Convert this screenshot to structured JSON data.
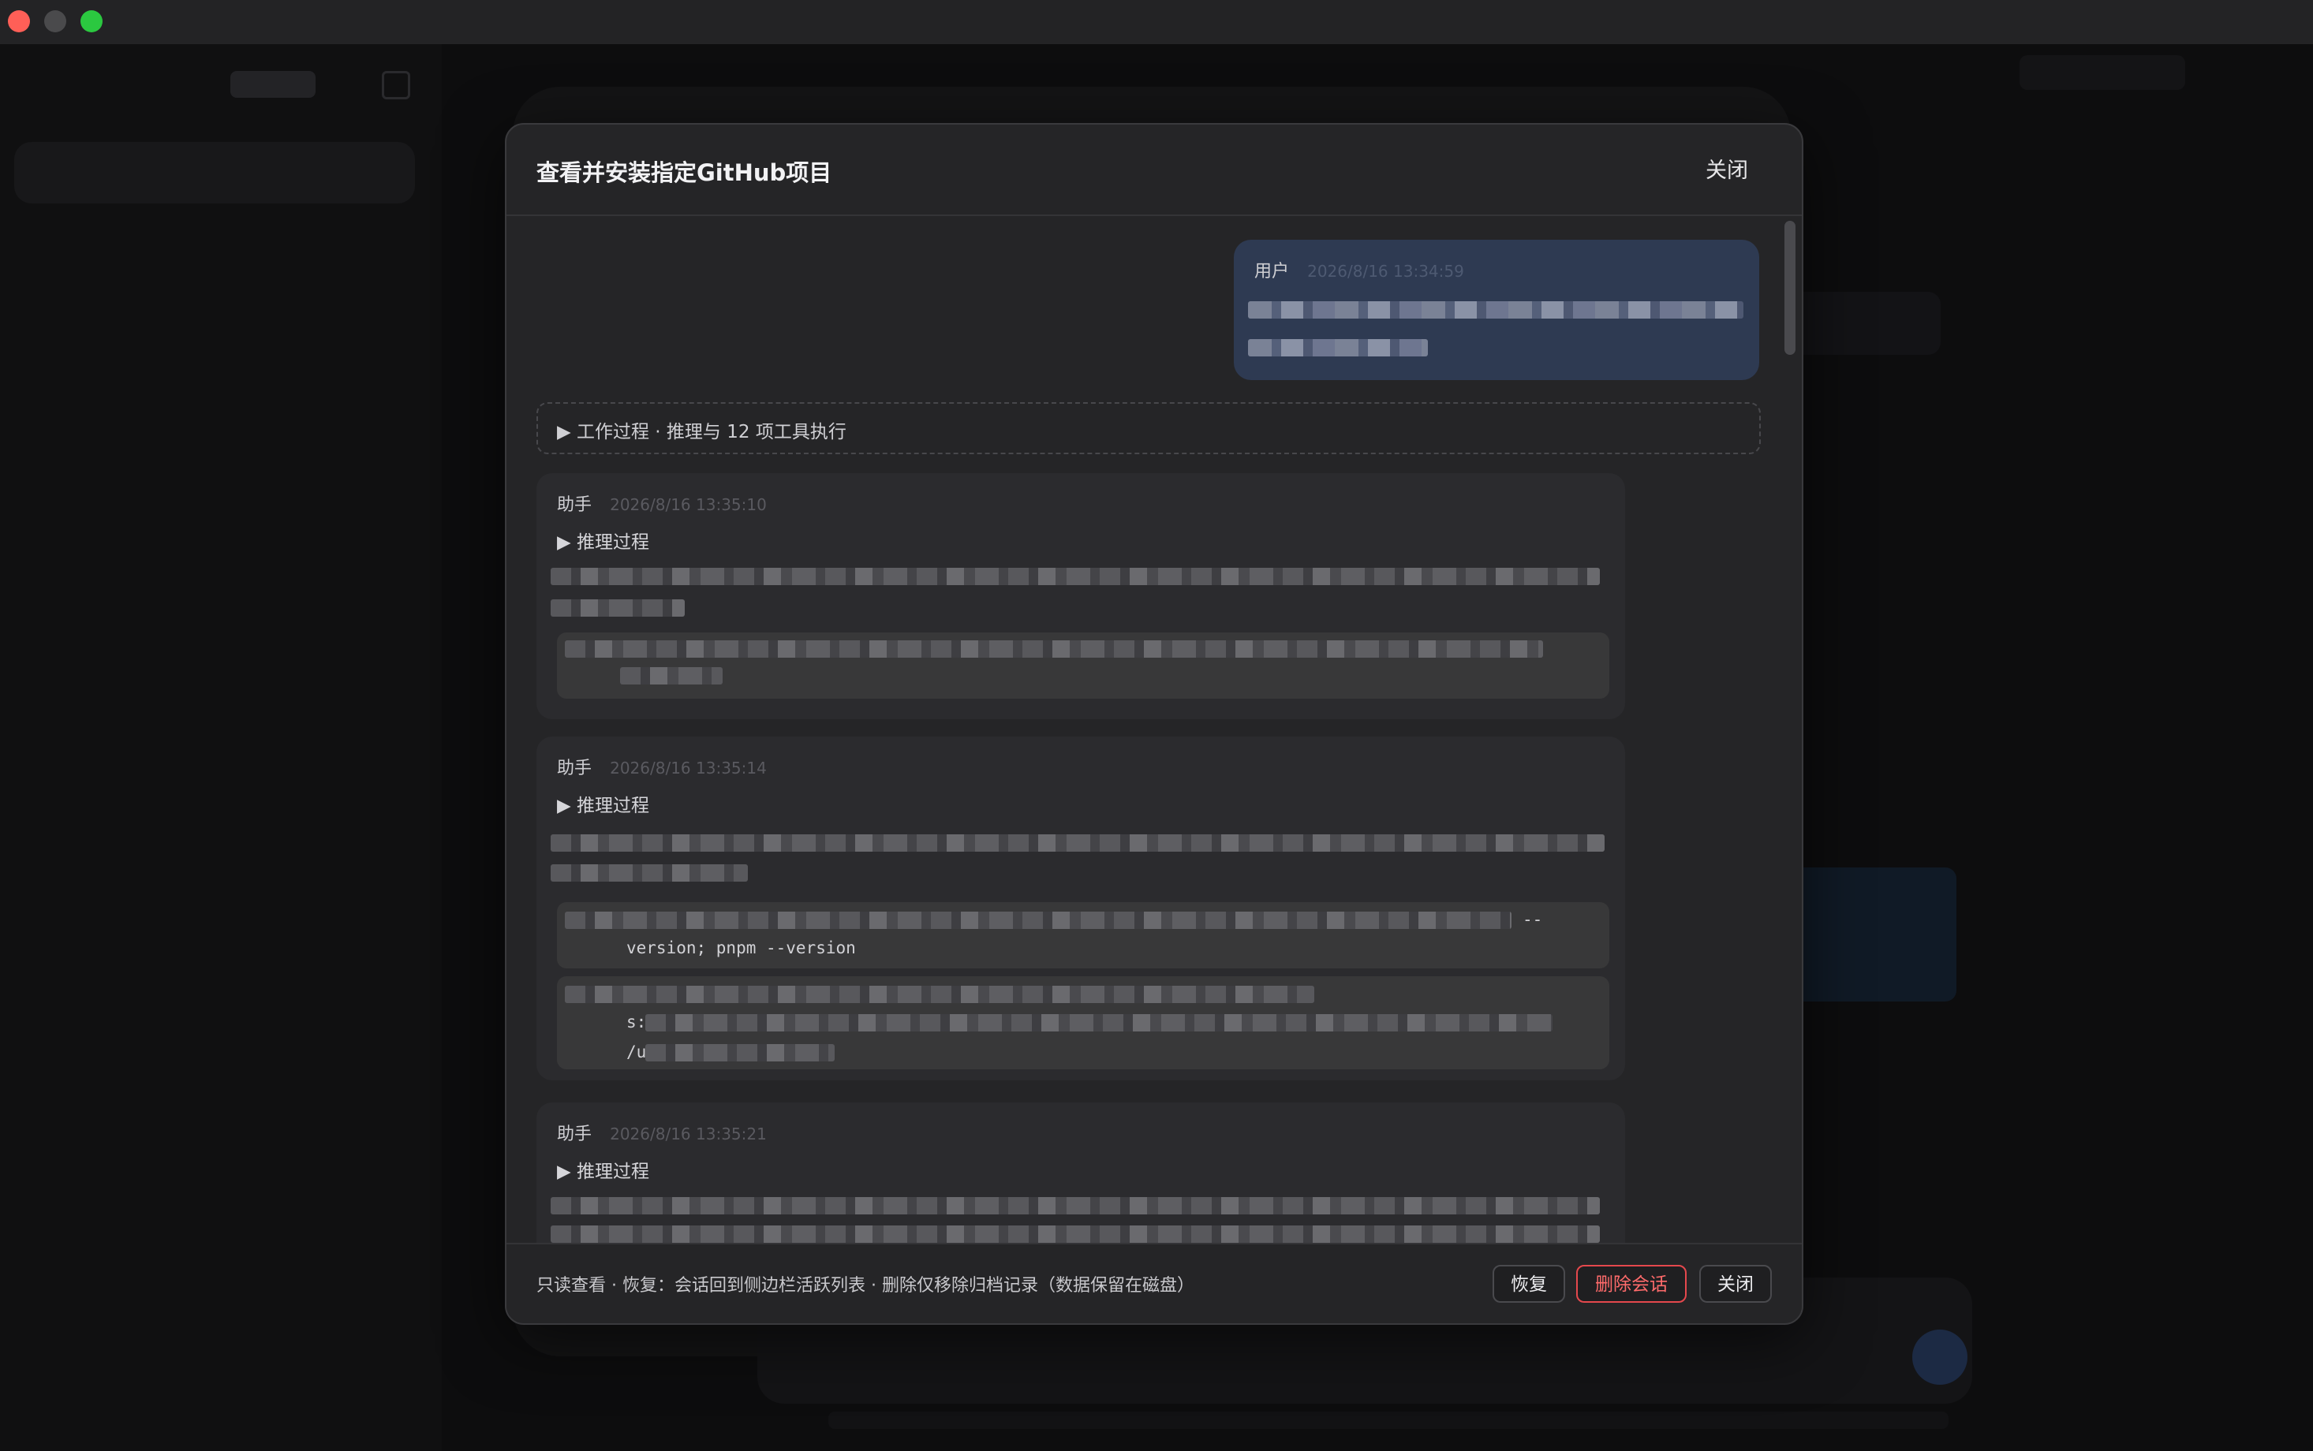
{
  "modal": {
    "title": "查看并安装指定GitHub项目",
    "header_close": "关闭",
    "user_message": {
      "role": "用户",
      "time": "2026/8/16 13:34:59"
    },
    "process_summary": "▶ 工作过程 · 推理与 12 项工具执行",
    "messages": [
      {
        "role": "助手",
        "time": "2026/8/16 13:35:10",
        "reasoning": "▶ 推理过程"
      },
      {
        "role": "助手",
        "time": "2026/8/16 13:35:14",
        "reasoning": "▶ 推理过程",
        "code_fragment_1": "--",
        "code_fragment_2": "version; pnpm --version",
        "code_fragment_3": "s:",
        "code_fragment_4": "/u"
      },
      {
        "role": "助手",
        "time": "2026/8/16 13:35:21",
        "reasoning": "▶ 推理过程"
      }
    ],
    "footer": {
      "note": "只读查看 · 恢复：会话回到侧边栏活跃列表 · 删除仅移除归档记录（数据保留在磁盘）",
      "restore": "恢复",
      "delete": "删除会话",
      "close": "关闭"
    }
  },
  "colors": {
    "danger": "#e5484d",
    "user_bubble": "#2e3a52",
    "modal_bg": "#252527"
  }
}
